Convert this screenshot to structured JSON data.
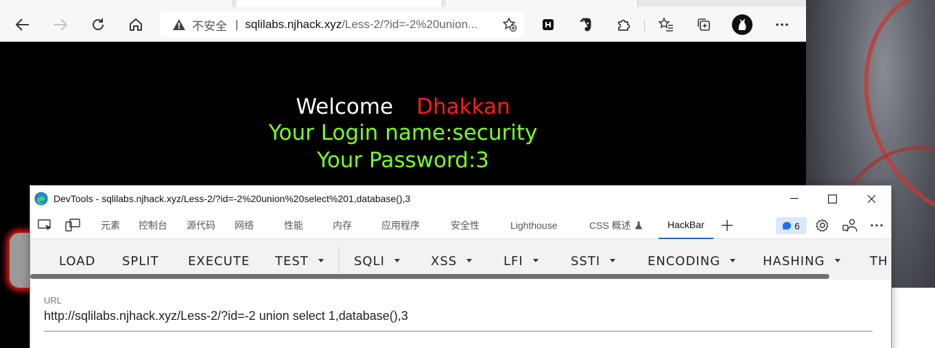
{
  "browser": {
    "nav": {
      "back": "back",
      "forward": "forward",
      "reload": "reload",
      "home": "home"
    },
    "address": {
      "security_label": "不安全",
      "separator": "|",
      "host": "sqlilabs.njhack.xyz",
      "path": "/Less-2/?id=-2%20union..."
    }
  },
  "page": {
    "welcome": "Welcome",
    "user": "Dhakkan",
    "login_line": "Your Login name:security",
    "password_line": "Your Password:3"
  },
  "devtools": {
    "title": "DevTools - sqlilabs.njhack.xyz/Less-2/?id=-2%20union%20select%201,database(),3",
    "tabs": [
      "元素",
      "控制台",
      "源代码",
      "网络",
      "性能",
      "内存",
      "应用程序",
      "安全性",
      "Lighthouse",
      "CSS 概述",
      "HackBar"
    ],
    "active_tab": "HackBar",
    "issues_count": "6"
  },
  "hackbar": {
    "buttons": [
      "LOAD",
      "SPLIT",
      "EXECUTE",
      "TEST",
      "SQLI",
      "XSS",
      "LFI",
      "SSTI",
      "ENCODING",
      "HASHING",
      "TH"
    ],
    "url_label": "URL",
    "url_value": "http://sqlilabs.njhack.xyz/Less-2/?id=-2 union select 1,database(),3"
  },
  "colors": {
    "welcome_user": "#ff1b1b",
    "green_text": "#7cff1e",
    "active_tab_underline": "#0f6cbd"
  }
}
